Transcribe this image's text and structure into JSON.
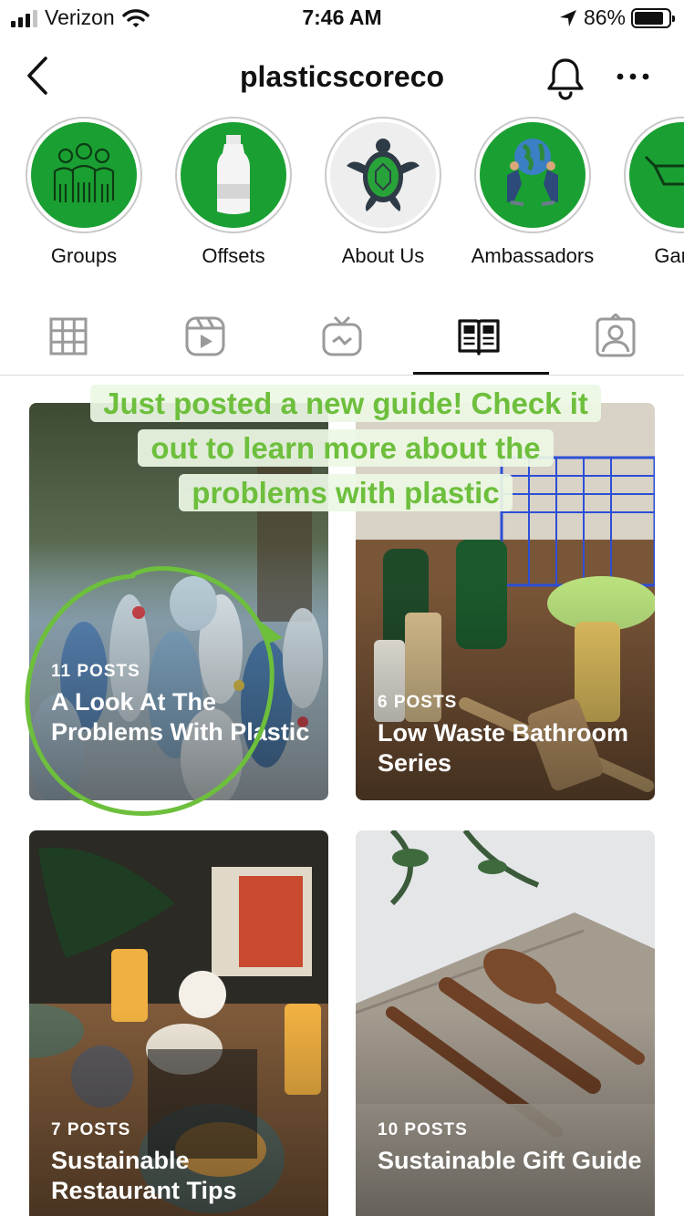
{
  "status_bar": {
    "carrier": "Verizon",
    "time": "7:46 AM",
    "battery_percent": "86%",
    "battery_level": 0.86,
    "icons": [
      "signal-icon",
      "wifi-icon",
      "location-arrow-icon",
      "battery-icon"
    ]
  },
  "header": {
    "username": "plasticscoreco",
    "icons": [
      "back-chevron-icon",
      "bell-icon",
      "more-icon"
    ]
  },
  "highlights": [
    {
      "label": "Groups",
      "icon": "people-icon"
    },
    {
      "label": "Offsets",
      "icon": "bottle-icon"
    },
    {
      "label": "About Us",
      "icon": "turtle-icon"
    },
    {
      "label": "Ambassadors",
      "icon": "globe-people-icon"
    },
    {
      "label": "Garde",
      "icon": "wheelbarrow-icon"
    }
  ],
  "tabs": {
    "items": [
      "grid-icon",
      "reels-icon",
      "igtv-icon",
      "guides-icon",
      "tagged-icon"
    ],
    "active": "guides-icon"
  },
  "callout": {
    "text": "Just posted a new guide! Check it out to learn more about the problems with plastic",
    "color": "#6dbf3c"
  },
  "guides": [
    {
      "count": "11 POSTS",
      "title": "A Look At The Problems With Plastic"
    },
    {
      "count": "6 POSTS",
      "title": "Low Waste Bathroom Series"
    },
    {
      "count": "7 POSTS",
      "title": "Sustainable Restaurant Tips"
    },
    {
      "count": "10 POSTS",
      "title": "Sustainable Gift Guide"
    }
  ],
  "colors": {
    "highlight_green": "#1aa032",
    "annotation_green": "#6dbf3c"
  }
}
